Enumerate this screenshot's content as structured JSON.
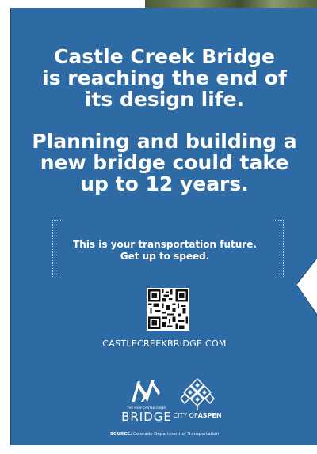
{
  "headline_1": [
    "Castle Creek Bridge",
    "is reaching the end of",
    "its design life."
  ],
  "headline_2": [
    "Planning and building a",
    "new bridge could take",
    "up to 12 years."
  ],
  "cta": [
    "This is your transportation future.",
    "Get up to speed."
  ],
  "url": "CASTLECREEKBRIDGE.COM",
  "bridge_logo": {
    "small": "THE NEW CASTLE CREEK",
    "name": "BRIDGE"
  },
  "aspen_logo": {
    "prefix": "CITY OF",
    "name": "ASPEN"
  },
  "source": {
    "label": "SOURCE:",
    "text": "Colorado Department of Transportation"
  },
  "colors": {
    "poster": "#2e6aa3",
    "text": "#ffffff"
  }
}
